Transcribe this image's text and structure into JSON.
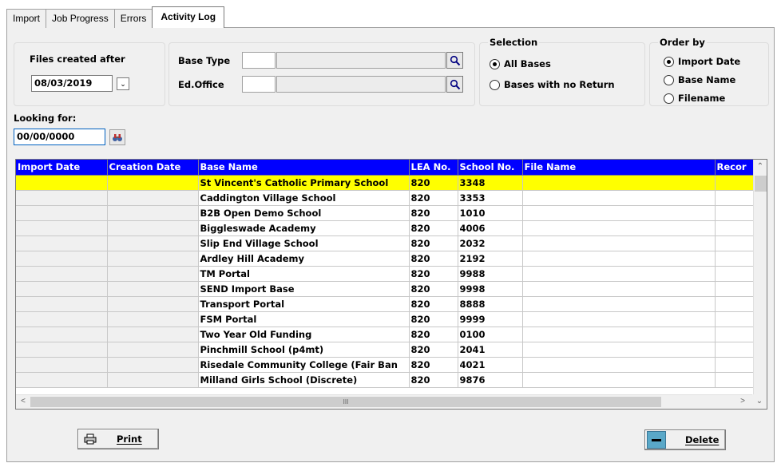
{
  "tabs": [
    "Import",
    "Job Progress",
    "Errors",
    "Activity Log"
  ],
  "filters": {
    "files_created_after_label": "Files created after",
    "files_created_after_value": "08/03/2019",
    "base_type_label": "Base Type",
    "ed_office_label": "Ed.Office",
    "looking_for_label": "Looking for:",
    "looking_for_value": "00/00/0000"
  },
  "selection": {
    "title": "Selection",
    "options": [
      "All Bases",
      "Bases with no Return"
    ],
    "selected": "All Bases"
  },
  "order_by": {
    "title": "Order by",
    "options": [
      "Import Date",
      "Base Name",
      "Filename"
    ],
    "selected": "Import Date"
  },
  "grid": {
    "columns": [
      "Import Date",
      "Creation Date",
      "Base Name",
      "LEA No.",
      "School No.",
      "File Name",
      "Recor"
    ],
    "rows": [
      [
        "",
        "",
        "St Vincent's Catholic Primary School",
        "820",
        "3348",
        "",
        ""
      ],
      [
        "",
        "",
        "Caddington Village School",
        "820",
        "3353",
        "",
        ""
      ],
      [
        "",
        "",
        "B2B Open Demo School",
        "820",
        "1010",
        "",
        ""
      ],
      [
        "",
        "",
        "Biggleswade Academy",
        "820",
        "4006",
        "",
        ""
      ],
      [
        "",
        "",
        "Slip End Village School",
        "820",
        "2032",
        "",
        ""
      ],
      [
        "",
        "",
        "Ardley Hill Academy",
        "820",
        "2192",
        "",
        ""
      ],
      [
        "",
        "",
        "TM Portal",
        "820",
        "9988",
        "",
        ""
      ],
      [
        "",
        "",
        "SEND Import Base",
        "820",
        "9998",
        "",
        ""
      ],
      [
        "",
        "",
        "Transport Portal",
        "820",
        "8888",
        "",
        ""
      ],
      [
        "",
        "",
        "FSM Portal",
        "820",
        "9999",
        "",
        ""
      ],
      [
        "",
        "",
        "Two Year Old Funding",
        "820",
        "0100",
        "",
        ""
      ],
      [
        "",
        "",
        "Pinchmill School (p4mt)",
        "820",
        "2041",
        "",
        ""
      ],
      [
        "",
        "",
        "Risedale Community College (Fair Ban",
        "820",
        "4021",
        "",
        ""
      ],
      [
        "",
        "",
        "Milland Girls School (Discrete)",
        "820",
        "9876",
        "",
        ""
      ]
    ],
    "selected_row": 0
  },
  "buttons": {
    "print": "Print",
    "delete": "Delete"
  },
  "colors": {
    "header_bg": "#0000ff",
    "selected_row": "#ffff00"
  }
}
